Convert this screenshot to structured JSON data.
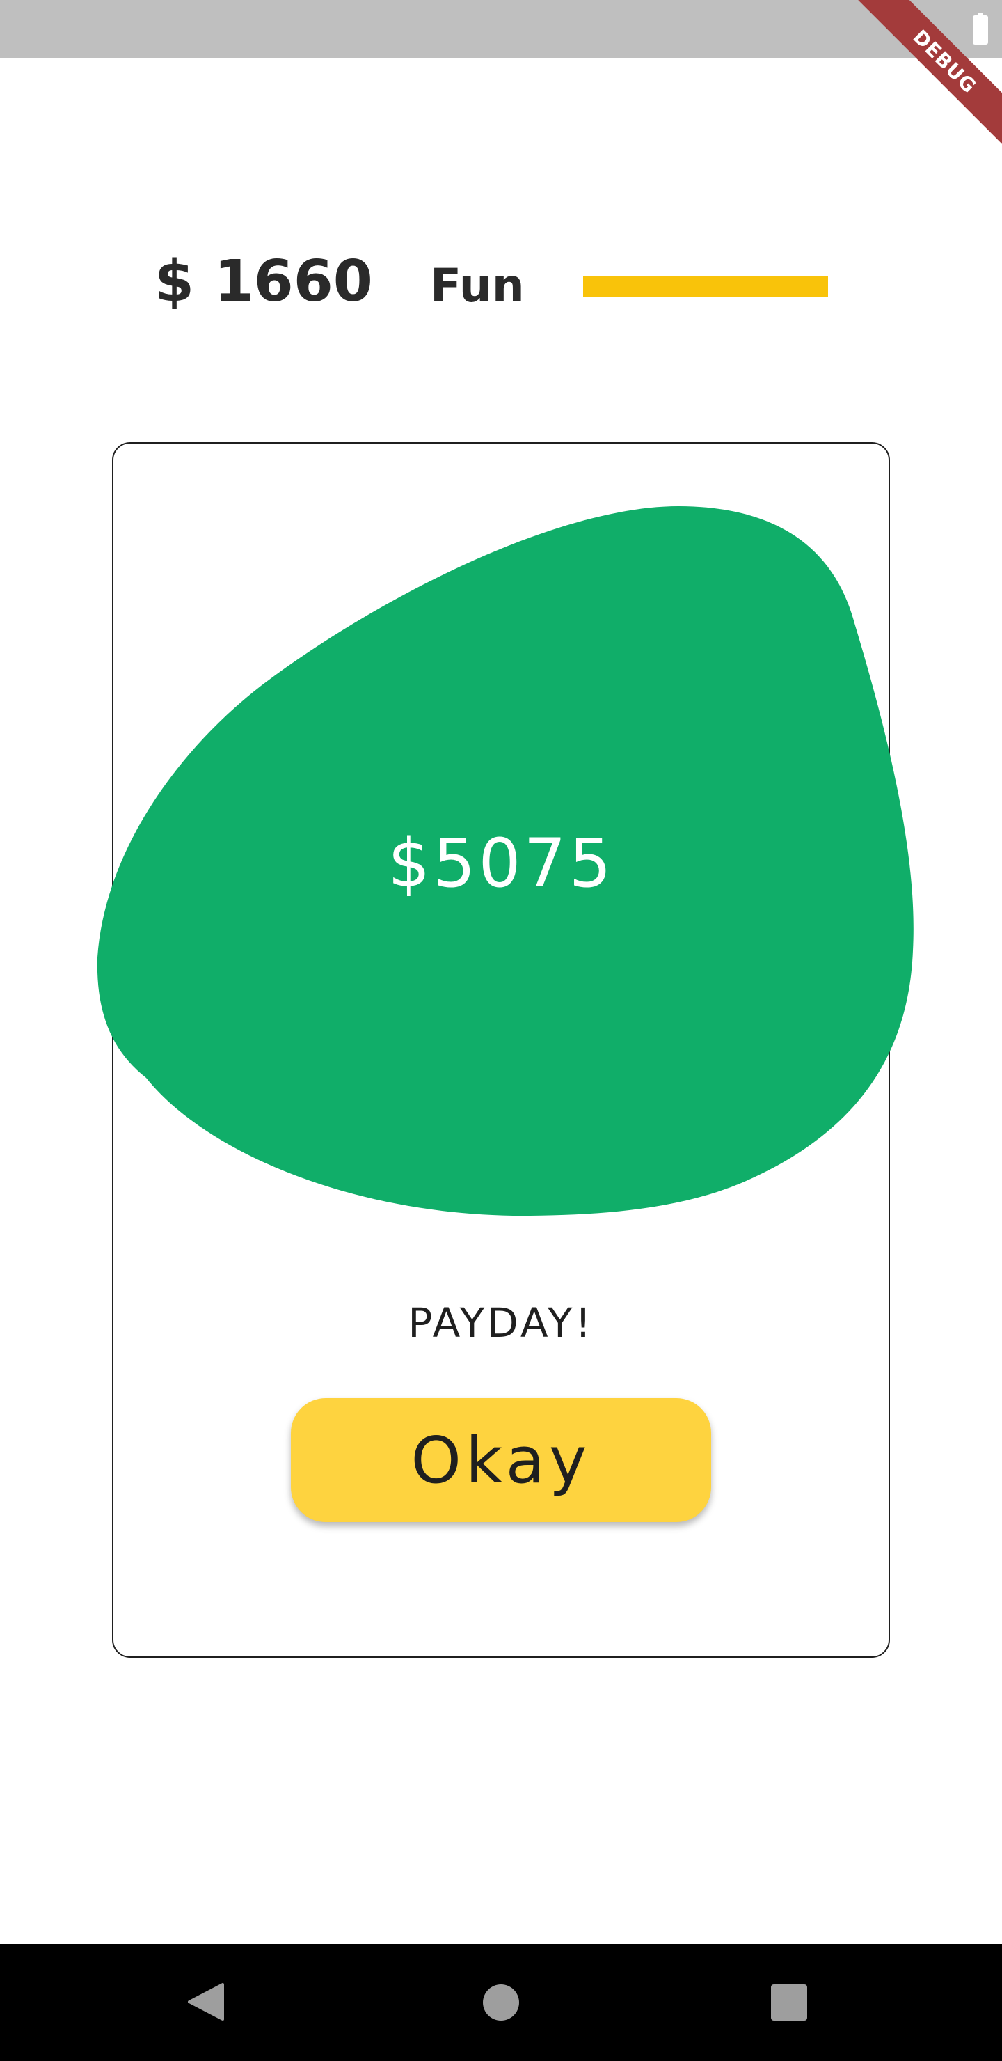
{
  "status_bar": {
    "battery_icon": "battery-full-icon",
    "debug_label": "DEBUG"
  },
  "header": {
    "money": "$ 1660",
    "stat_label": "Fun",
    "stat_level": 1.0,
    "stat_color": "#f9c30a"
  },
  "card": {
    "amount": "$5075",
    "blob_color": "#10ae69",
    "title": "PAYDAY!",
    "button_label": "Okay",
    "button_color": "#fed33f"
  },
  "nav_bar": {
    "back_icon": "back-triangle-icon",
    "home_icon": "home-circle-icon",
    "recents_icon": "recents-square-icon"
  }
}
